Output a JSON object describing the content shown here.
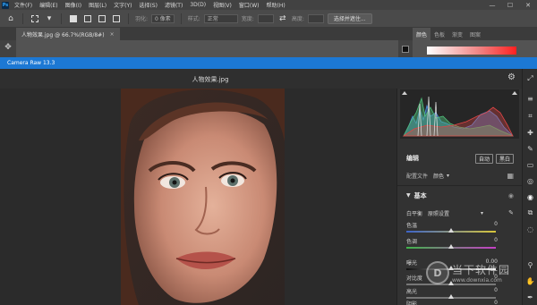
{
  "menubar": {
    "logo": "Ps",
    "items": [
      "文件(F)",
      "编辑(E)",
      "图像(I)",
      "图层(L)",
      "文字(Y)",
      "选择(S)",
      "滤镜(T)",
      "3D(D)",
      "视图(V)",
      "窗口(W)",
      "帮助(H)"
    ],
    "minimize": "—",
    "maximize": "☐",
    "close": "✕"
  },
  "optbar": {
    "feather_label": "羽化:",
    "feather_value": "0 像素",
    "style_label": "样式:",
    "style_value": "正常",
    "width_label": "宽度:",
    "height_label": "高度:",
    "select_mask_button": "选择并遮住..."
  },
  "document": {
    "tab_title": "人物效果.jpg @ 66.7%(RGB/8#)",
    "tab_close": "×"
  },
  "right_panel": {
    "tabs": [
      "颜色",
      "色板",
      "渐变",
      "图案"
    ],
    "active_tab": "颜色"
  },
  "camera_raw": {
    "title": "Camera Raw 13.3",
    "filename": "人物效果.jpg",
    "edit_title": "编辑",
    "auto_button": "自动",
    "bw_button": "黑白",
    "profile_label": "配置文件",
    "profile_value": "颜色",
    "basic_title": "基本",
    "wb_label": "白平衡",
    "wb_value": "原照设置",
    "sliders": [
      {
        "label": "色温",
        "value": "0",
        "fraction": 0.5
      },
      {
        "label": "色调",
        "value": "0",
        "fraction": 0.5
      },
      {
        "label": "曝光",
        "value": "0.00",
        "fraction": 0.5
      },
      {
        "label": "对比度",
        "value": "0",
        "fraction": 0.5
      },
      {
        "label": "高光",
        "value": "0",
        "fraction": 0.5
      },
      {
        "label": "阴影",
        "value": "0",
        "fraction": 0.5
      }
    ]
  },
  "watermark": {
    "badge": "D",
    "name": "当下软件园",
    "url": "www.downxia.com"
  },
  "colors": {
    "cr_titlebar": "#1c78d4",
    "histogram_red": "#e04545",
    "histogram_green": "#4fbf7a",
    "histogram_blue": "#4a8ee0"
  }
}
